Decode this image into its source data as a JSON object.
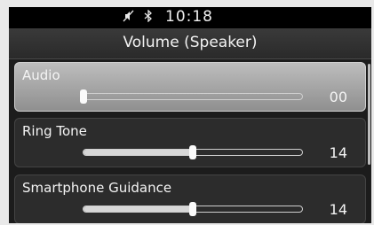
{
  "status_bar": {
    "icons": [
      "mute-icon",
      "bluetooth-icon"
    ],
    "time": "10:18"
  },
  "title": "Volume (Speaker)",
  "items": [
    {
      "label": "Audio",
      "value": "00",
      "level": 0.0,
      "selected": true
    },
    {
      "label": "Ring Tone",
      "value": "14",
      "level": 0.5,
      "selected": false
    },
    {
      "label": "Smartphone Guidance",
      "value": "14",
      "level": 0.5,
      "selected": false
    }
  ]
}
